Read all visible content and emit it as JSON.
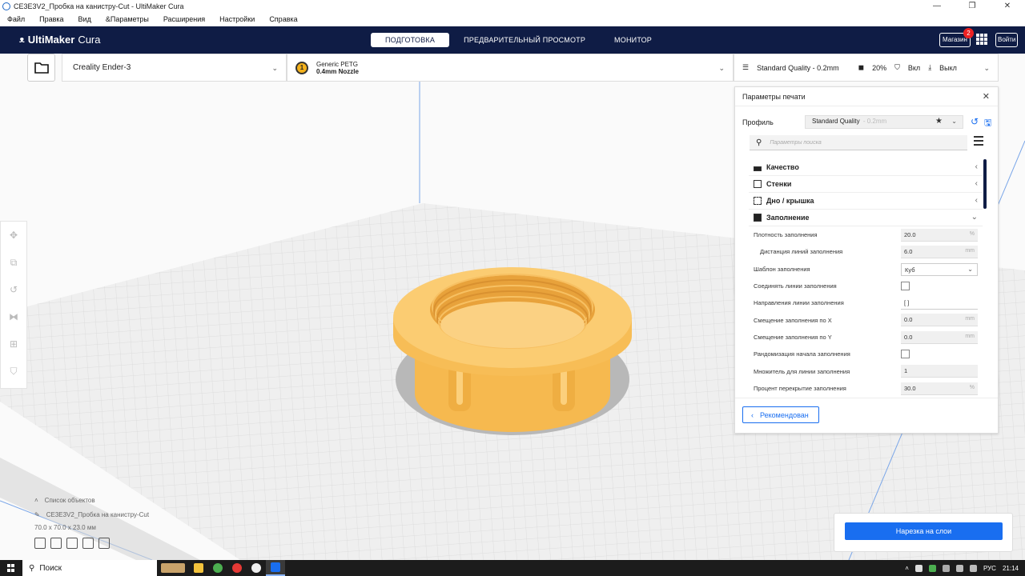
{
  "window": {
    "title": "CE3E3V2_Пробка на канистру-Cut - UltiMaker Cura",
    "controls": [
      "—",
      "❐",
      "✕"
    ]
  },
  "menu": [
    "Файл",
    "Правка",
    "Вид",
    "&Параметры",
    "Расширения",
    "Настройки",
    "Справка"
  ],
  "header": {
    "brand_bold": "UltiMaker",
    "brand_light": "Cura",
    "stages": [
      "ПОДГОТОВКА",
      "ПРЕДВАРИТЕЛЬНЫЙ ПРОСМОТР",
      "МОНИТОР"
    ],
    "active_stage": "ПОДГОТОВКА",
    "shop_label": "Магазин",
    "shop_badge": "2",
    "signin_label": "Войти"
  },
  "toolbar": {
    "printer": "Creality Ender-3",
    "material_name": "Generic PETG",
    "nozzle": "0.4mm Nozzle",
    "extruder_number": "1",
    "quality": "Standard Quality - 0.2mm",
    "infill": "20%",
    "support": "Вкл",
    "adhesion": "Выкл"
  },
  "print_settings": {
    "title": "Параметры печати",
    "profile_label": "Профиль",
    "profile_value": "Standard Quality",
    "profile_suffix": "- 0.2mm",
    "search_placeholder": "Параметры поиска",
    "categories": [
      {
        "label": "Качество",
        "state": "collapsed"
      },
      {
        "label": "Стенки",
        "state": "collapsed"
      },
      {
        "label": "Дно / крышка",
        "state": "collapsed"
      },
      {
        "label": "Заполнение",
        "state": "expanded"
      }
    ],
    "rows": [
      {
        "label": "Плотность заполнения",
        "kind": "value",
        "value": "20.0",
        "unit": "%"
      },
      {
        "label": "Дистанция линий заполнения",
        "kind": "value",
        "value": "6.0",
        "unit": "mm",
        "child": true
      },
      {
        "label": "Шаблон заполнения",
        "kind": "select",
        "value": "Куб"
      },
      {
        "label": "Соединять линии заполнения",
        "kind": "checkbox"
      },
      {
        "label": "Направления линии заполнения",
        "kind": "text",
        "value": "[ ]"
      },
      {
        "label": "Смещение заполнения по X",
        "kind": "value",
        "value": "0.0",
        "unit": "mm"
      },
      {
        "label": "Смещение заполнения по Y",
        "kind": "value",
        "value": "0.0",
        "unit": "mm"
      },
      {
        "label": "Рандомизация начала заполнения",
        "kind": "checkbox"
      },
      {
        "label": "Множитель для линии заполнения",
        "kind": "value",
        "value": "1",
        "unit": ""
      },
      {
        "label": "Процент перекрытие заполнения",
        "kind": "value",
        "value": "30.0",
        "unit": "%"
      }
    ],
    "recommended_label": "Рекомендован"
  },
  "object_list": {
    "header": "Список объектов",
    "object_name": "CE3E3V2_Пробка на канистру-Cut",
    "dimensions": "70.0 x 70.0 x 23.0 мм"
  },
  "slice_button": "Нарезка на слои",
  "taskbar": {
    "search_placeholder": "Поиск",
    "language": "РУС",
    "time": "21:14"
  },
  "colors": {
    "header_bg": "#0f1c45",
    "accent": "#196ef0",
    "model": "#f8c15c",
    "model_shadow": "#e3a43c",
    "build_plate": "#f0f0f0",
    "grid_line": "#d6d6d6",
    "shadow": "#b9b9b9"
  }
}
